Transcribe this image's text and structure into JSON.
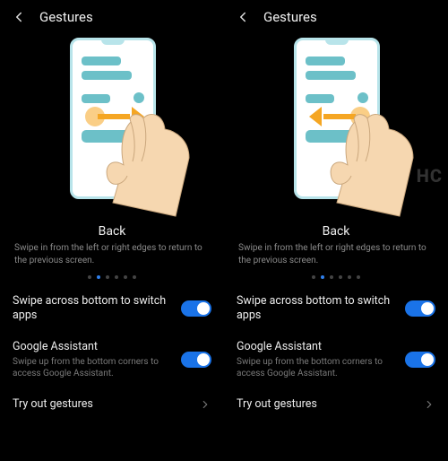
{
  "panes": [
    {
      "header": {
        "title": "Gestures"
      },
      "tutorial": {
        "title": "Back",
        "description": "Swipe in from the left or right edges to return to the previous screen.",
        "arrow_direction": "right",
        "page_index": 1,
        "page_count": 6
      },
      "settings": {
        "swipe_bottom": {
          "label": "Swipe across bottom to switch apps",
          "enabled": true
        },
        "assistant": {
          "label": "Google Assistant",
          "sub": "Swipe up from the bottom corners to access Google Assistant.",
          "enabled": true
        },
        "try": {
          "label": "Try out gestures"
        }
      }
    },
    {
      "header": {
        "title": "Gestures"
      },
      "tutorial": {
        "title": "Back",
        "description": "Swipe in from the left or right edges to return to the previous screen.",
        "arrow_direction": "left",
        "page_index": 1,
        "page_count": 6
      },
      "settings": {
        "swipe_bottom": {
          "label": "Swipe across bottom to switch apps",
          "enabled": true
        },
        "assistant": {
          "label": "Google Assistant",
          "sub": "Swipe up from the bottom corners to access Google Assistant.",
          "enabled": true
        },
        "try": {
          "label": "Try out gestures"
        }
      }
    }
  ],
  "watermark": "HC"
}
